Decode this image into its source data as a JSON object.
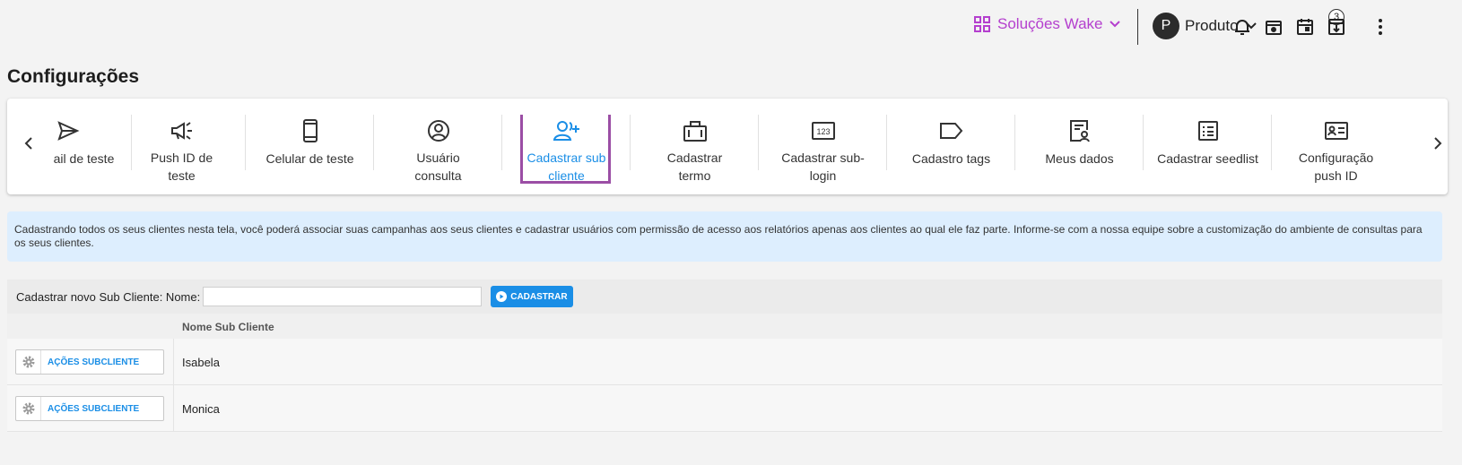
{
  "topbar": {
    "solutions_label": "Soluções Wake",
    "profile_initial": "P",
    "profile_name": "Produto",
    "notifications_badge": "3"
  },
  "page": {
    "title": "Configurações"
  },
  "carousel": {
    "items": [
      {
        "label": "ail de teste",
        "icon": "send-icon"
      },
      {
        "label": "Push ID de teste",
        "icon": "megaphone-icon"
      },
      {
        "label": "Celular de teste",
        "icon": "phone-icon"
      },
      {
        "label": "Usuário consulta",
        "icon": "user-circle-icon"
      },
      {
        "label": "Cadastrar sub cliente",
        "icon": "user-add-icon",
        "active": true
      },
      {
        "label": "Cadastrar termo",
        "icon": "briefcase-icon"
      },
      {
        "label": "Cadastrar sub-login",
        "icon": "number-123-icon"
      },
      {
        "label": "Cadastro tags",
        "icon": "tag-icon"
      },
      {
        "label": "Meus dados",
        "icon": "profile-doc-icon"
      },
      {
        "label": "Cadastrar seedlist",
        "icon": "list-icon"
      },
      {
        "label": "Configuração push ID",
        "icon": "id-card-icon"
      }
    ]
  },
  "info": {
    "text": "Cadastrando todos os seus clientes nesta tela, você poderá associar suas campanhas aos seus clientes e cadastrar usuários com permissão de acesso aos relatórios apenas aos clientes ao qual ele faz parte. Informe-se com a nossa equipe sobre a customização do ambiente de consultas para os seus clientes."
  },
  "form": {
    "label": "Cadastrar novo Sub Cliente: Nome:",
    "input_value": "",
    "button_label": "CADASTRAR"
  },
  "table": {
    "header_name": "Nome Sub Cliente",
    "actions_label": "AÇÕES SUBCLIENTE",
    "rows": [
      {
        "name": "Isabela"
      },
      {
        "name": "Monica"
      }
    ]
  },
  "colors": {
    "accent": "#1a8ee6",
    "brand": "#b43fce",
    "active_border": "#9b4ea5",
    "info_bg": "#ddeefe"
  }
}
